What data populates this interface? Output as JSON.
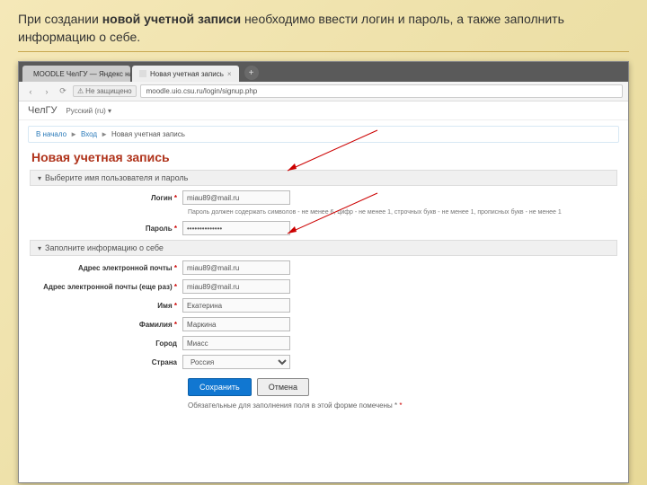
{
  "slide": {
    "caption_prefix": "При создании ",
    "caption_bold": "новой учетной записи",
    "caption_suffix": " необходимо ввести логин и пароль, а также заполнить информацию о себе."
  },
  "browser": {
    "tabs": [
      {
        "label": "MOODLE ЧелГУ — Яндекс наш..."
      },
      {
        "label": "Новая учетная запись"
      }
    ],
    "security_text": "Не защищено",
    "url": "moodle.uio.csu.ru/login/signup.php"
  },
  "header": {
    "site": "ЧелГУ",
    "lang": "Русский (ru) ▾"
  },
  "breadcrumb": {
    "home": "В начало",
    "login": "Вход",
    "current": "Новая учетная запись"
  },
  "page": {
    "title": "Новая учетная запись"
  },
  "sections": {
    "credentials": {
      "legend": "Выберите имя пользователя и пароль"
    },
    "about": {
      "legend": "Заполните информацию о себе"
    }
  },
  "fields": {
    "login_label": "Логин",
    "login_value": "miau89@mail.ru",
    "password_label": "Пароль",
    "password_value": "••••••••••••••",
    "password_hint": "Пароль должен содержать символов - не менее 6, цифр - не менее 1, строчных букв - не менее 1, прописных букв - не менее 1",
    "email_label": "Адрес электронной почты",
    "email_value": "miau89@mail.ru",
    "email2_label": "Адрес электронной почты (еще раз)",
    "email2_value": "miau89@mail.ru",
    "firstname_label": "Имя",
    "firstname_value": "Екатерина",
    "lastname_label": "Фамилия",
    "lastname_value": "Маркина",
    "city_label": "Город",
    "city_value": "Миасс",
    "country_label": "Страна",
    "country_value": "Россия"
  },
  "buttons": {
    "save": "Сохранить",
    "cancel": "Отмена"
  },
  "notes": {
    "required": "Обязательные для заполнения поля в этой форме помечены *"
  }
}
